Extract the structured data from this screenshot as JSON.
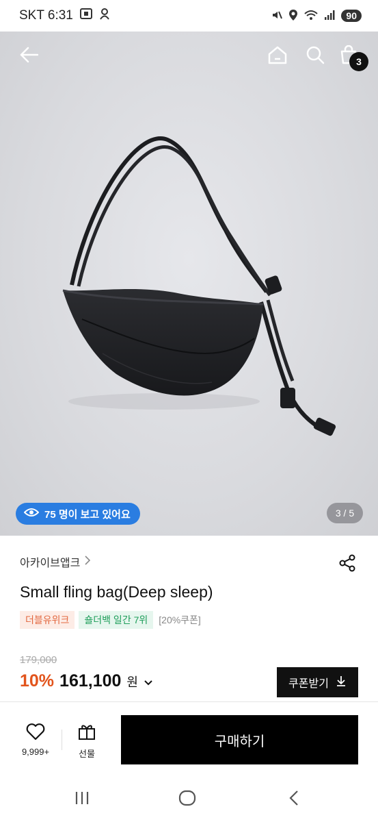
{
  "status_bar": {
    "carrier_time": "SKT 6:31",
    "battery": "90",
    "icons": [
      "screenshot-icon",
      "notification-icon",
      "mute-icon",
      "location-icon",
      "wifi-icon",
      "signal-icon"
    ]
  },
  "header": {
    "back_icon": "back-arrow-icon",
    "home_icon": "home-icon",
    "search_icon": "search-icon",
    "cart_icon": "cart-icon",
    "cart_count": "3"
  },
  "gallery": {
    "viewers_text": "75 명이 보고 있어요",
    "page_counter": "3 / 5"
  },
  "product": {
    "brand": "아카이브앱크",
    "title": "Small fling bag(Deep sleep)",
    "tags": {
      "badge_1": "더블유위크",
      "badge_2": "숄더백 일간 7위",
      "coupon_tag": "[20%쿠폰]"
    },
    "original_price": "179,000",
    "discount": "10%",
    "price": "161,100",
    "currency": "원",
    "coupon_button": "쿠폰받기"
  },
  "bottom_bar": {
    "like_count": "9,999+",
    "gift_label": "선물",
    "buy_label": "구매하기"
  },
  "colors": {
    "accent_blue": "#2a7de1",
    "discount_orange": "#e2541c",
    "badge_green": "#1e9e5a"
  }
}
